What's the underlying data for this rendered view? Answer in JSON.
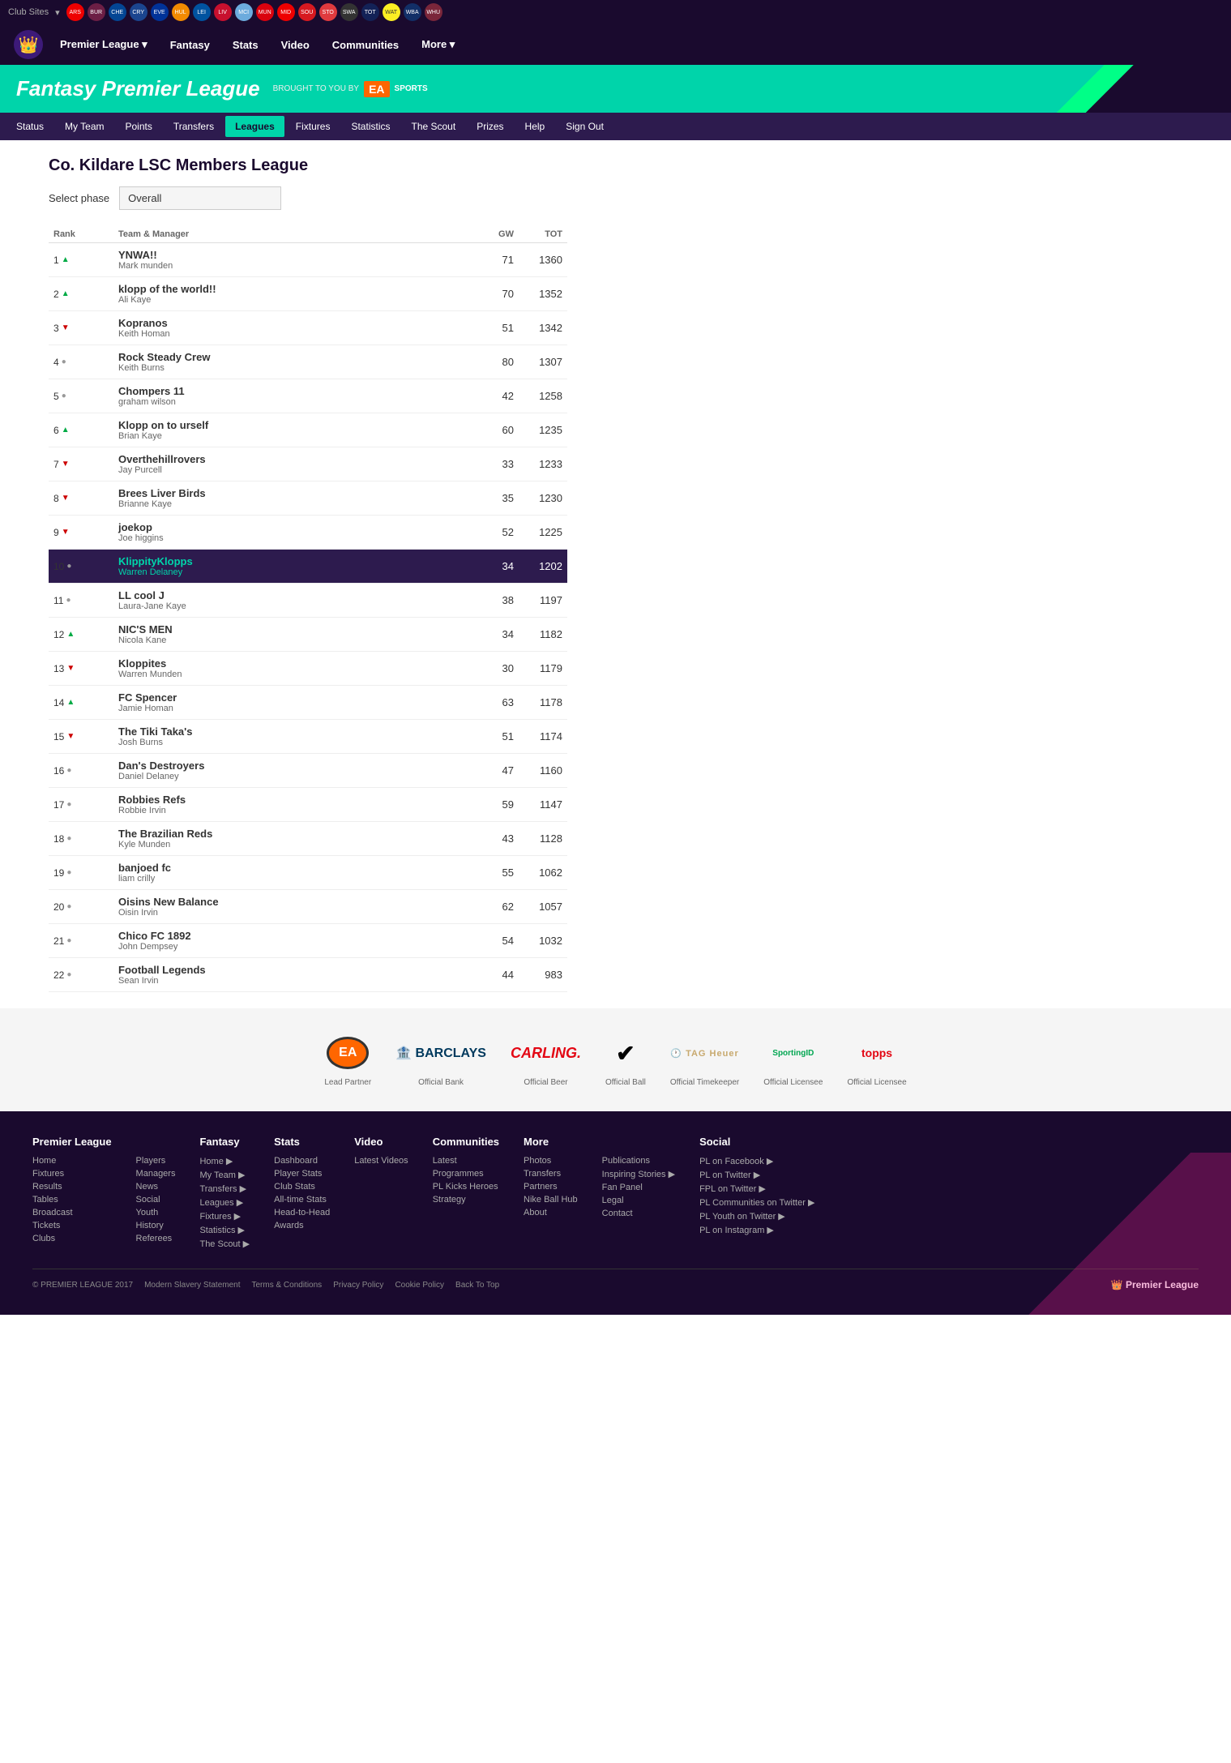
{
  "topbar": {
    "club_sites_label": "Club Sites",
    "clubs": [
      "ARS",
      "BUR",
      "CHE",
      "CRY",
      "EVE",
      "HUL",
      "LEI",
      "LIV",
      "MCI",
      "MUN",
      "MID",
      "SOU",
      "STO",
      "SWA",
      "TOT",
      "WAT",
      "WBA",
      "WHU"
    ]
  },
  "main_nav": {
    "items": [
      {
        "label": "Premier League",
        "has_arrow": true
      },
      {
        "label": "Fantasy"
      },
      {
        "label": "Stats"
      },
      {
        "label": "Video"
      },
      {
        "label": "Communities"
      },
      {
        "label": "More",
        "has_arrow": true
      }
    ]
  },
  "fpl_banner": {
    "title": "Fantasy Premier League",
    "brought_by": "BROUGHT TO YOU BY",
    "sponsor": "EA SPORTS"
  },
  "sub_nav": {
    "items": [
      {
        "label": "Status"
      },
      {
        "label": "My Team"
      },
      {
        "label": "Points"
      },
      {
        "label": "Transfers"
      },
      {
        "label": "Leagues",
        "active": true
      },
      {
        "label": "Fixtures"
      },
      {
        "label": "Statistics"
      },
      {
        "label": "The Scout"
      },
      {
        "label": "Prizes"
      },
      {
        "label": "Help"
      },
      {
        "label": "Sign Out"
      }
    ]
  },
  "league": {
    "title": "Co. Kildare LSC Members League",
    "phase_label": "Select phase",
    "phase_value": "Overall",
    "table": {
      "headers": [
        "Rank",
        "Team & Manager",
        "GW",
        "TOT"
      ],
      "rows": [
        {
          "rank": 1,
          "trend": "up",
          "team": "YNWA!!",
          "manager": "Mark munden",
          "gw": 71,
          "tot": 1360,
          "highlight": false
        },
        {
          "rank": 2,
          "trend": "up",
          "team": "klopp of the world!!",
          "manager": "Ali Kaye",
          "gw": 70,
          "tot": 1352,
          "highlight": false
        },
        {
          "rank": 3,
          "trend": "down",
          "team": "Kopranos",
          "manager": "Keith Homan",
          "gw": 51,
          "tot": 1342,
          "highlight": false
        },
        {
          "rank": 4,
          "trend": "neutral",
          "team": "Rock Steady Crew",
          "manager": "Keith Burns",
          "gw": 80,
          "tot": 1307,
          "highlight": false
        },
        {
          "rank": 5,
          "trend": "neutral",
          "team": "Chompers 11",
          "manager": "graham wilson",
          "gw": 42,
          "tot": 1258,
          "highlight": false
        },
        {
          "rank": 6,
          "trend": "up",
          "team": "Klopp on to urself",
          "manager": "Brian Kaye",
          "gw": 60,
          "tot": 1235,
          "highlight": false
        },
        {
          "rank": 7,
          "trend": "down",
          "team": "Overthehillrovers",
          "manager": "Jay Purcell",
          "gw": 33,
          "tot": 1233,
          "highlight": false
        },
        {
          "rank": 8,
          "trend": "down",
          "team": "Brees Liver Birds",
          "manager": "Brianne Kaye",
          "gw": 35,
          "tot": 1230,
          "highlight": false
        },
        {
          "rank": 9,
          "trend": "down",
          "team": "joekop",
          "manager": "Joe higgins",
          "gw": 52,
          "tot": 1225,
          "highlight": false
        },
        {
          "rank": 10,
          "trend": "neutral",
          "team": "KlippityKlopps",
          "manager": "Warren Delaney",
          "gw": 34,
          "tot": 1202,
          "highlight": true
        },
        {
          "rank": 11,
          "trend": "neutral",
          "team": "LL cool J",
          "manager": "Laura-Jane Kaye",
          "gw": 38,
          "tot": 1197,
          "highlight": false
        },
        {
          "rank": 12,
          "trend": "up",
          "team": "NIC'S MEN",
          "manager": "Nicola Kane",
          "gw": 34,
          "tot": 1182,
          "highlight": false
        },
        {
          "rank": 13,
          "trend": "down",
          "team": "Kloppites",
          "manager": "Warren Munden",
          "gw": 30,
          "tot": 1179,
          "highlight": false
        },
        {
          "rank": 14,
          "trend": "up",
          "team": "FC Spencer",
          "manager": "Jamie Homan",
          "gw": 63,
          "tot": 1178,
          "highlight": false
        },
        {
          "rank": 15,
          "trend": "down",
          "team": "The Tiki Taka's",
          "manager": "Josh Burns",
          "gw": 51,
          "tot": 1174,
          "highlight": false
        },
        {
          "rank": 16,
          "trend": "neutral",
          "team": "Dan's Destroyers",
          "manager": "Daniel Delaney",
          "gw": 47,
          "tot": 1160,
          "highlight": false
        },
        {
          "rank": 17,
          "trend": "neutral",
          "team": "Robbies Refs",
          "manager": "Robbie Irvin",
          "gw": 59,
          "tot": 1147,
          "highlight": false
        },
        {
          "rank": 18,
          "trend": "neutral",
          "team": "The Brazilian Reds",
          "manager": "Kyle Munden",
          "gw": 43,
          "tot": 1128,
          "highlight": false
        },
        {
          "rank": 19,
          "trend": "neutral",
          "team": "banjoed fc",
          "manager": "liam crilly",
          "gw": 55,
          "tot": 1062,
          "highlight": false
        },
        {
          "rank": 20,
          "trend": "neutral",
          "team": "Oisins New Balance",
          "manager": "Oisin Irvin",
          "gw": 62,
          "tot": 1057,
          "highlight": false
        },
        {
          "rank": 21,
          "trend": "neutral",
          "team": "Chico FC 1892",
          "manager": "John Dempsey",
          "gw": 54,
          "tot": 1032,
          "highlight": false
        },
        {
          "rank": 22,
          "trend": "neutral",
          "team": "Football Legends",
          "manager": "Sean Irvin",
          "gw": 44,
          "tot": 983,
          "highlight": false
        }
      ]
    }
  },
  "sponsors": [
    {
      "label": "Lead Partner",
      "name": "EA Sports"
    },
    {
      "label": "Official Bank",
      "name": "Barclays"
    },
    {
      "label": "Official Beer",
      "name": "Carling"
    },
    {
      "label": "Official Ball",
      "name": "Nike"
    },
    {
      "label": "Official Timekeeper",
      "name": "TAG Heuer"
    },
    {
      "label": "Official Licensee",
      "name": "SportingID"
    },
    {
      "label": "Official Licensee",
      "name": "Topps"
    }
  ],
  "footer": {
    "columns": [
      {
        "title": "Premier League",
        "links": [
          "Home",
          "Fixtures",
          "Results",
          "Tables",
          "Broadcast",
          "Tickets",
          "Clubs"
        ]
      },
      {
        "title": "",
        "links": [
          "Players",
          "Managers",
          "News",
          "Social",
          "Youth",
          "History",
          "Referees"
        ]
      },
      {
        "title": "Fantasy",
        "links": [
          "Home ▶",
          "My Team ▶",
          "Transfers ▶",
          "Leagues ▶",
          "Fixtures ▶",
          "Statistics ▶",
          "The Scout ▶"
        ]
      },
      {
        "title": "Stats",
        "links": [
          "Dashboard",
          "Player Stats",
          "Club Stats",
          "All-time Stats",
          "Head-to-Head",
          "Awards"
        ]
      },
      {
        "title": "Video",
        "links": [
          "Latest Videos"
        ]
      },
      {
        "title": "Communities",
        "links": [
          "Latest",
          "Programmes",
          "PL Kicks Heroes",
          "Strategy"
        ]
      },
      {
        "title": "More",
        "links": [
          "Photos",
          "Transfers",
          "Partners",
          "Nike Ball Hub",
          "About"
        ]
      },
      {
        "title": "",
        "links": [
          "Publications",
          "Inspiring Stories ▶",
          "Fan Panel",
          "Legal",
          "Contact"
        ]
      },
      {
        "title": "Social",
        "links": [
          "PL on Facebook ▶",
          "PL on Twitter ▶",
          "FPL on Twitter ▶",
          "PL Communities on Twitter ▶",
          "PL Youth on Twitter ▶",
          "PL on Instagram ▶"
        ]
      }
    ],
    "bottom": {
      "copyright": "© PREMIER LEAGUE 2017",
      "links": [
        "Modern Slavery Statement",
        "Terms & Conditions",
        "Privacy Policy",
        "Cookie Policy",
        "Back To Top"
      ]
    }
  }
}
